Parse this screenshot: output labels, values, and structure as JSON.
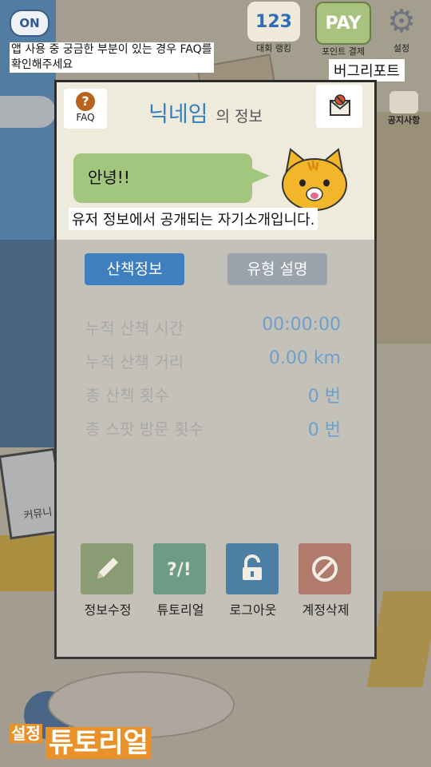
{
  "top": {
    "toggle_label": "ON",
    "rank_label": "대회 랭킹",
    "rank_glyph": "123",
    "pay_label": "포인트 결제",
    "pay_glyph": "PAY",
    "settings_label": "설정",
    "notice_label": "공지사항",
    "faq_hint": "앱 사용 중 궁금한 부분이 있는 경우 FAQ를 확인해주세요",
    "bug_hint": "버그리포트"
  },
  "panel": {
    "faq_label": "FAQ",
    "faq_glyph": "?",
    "nickname": "닉네임",
    "title_suffix": "의 정보",
    "greeting": "안녕!!",
    "intro_hint": "유저 정보에서 공개되는 자기소개입니다.",
    "tabs": [
      {
        "label": "산책정보",
        "active": true
      },
      {
        "label": "유형 설명",
        "active": false
      }
    ],
    "stats": [
      {
        "label": "누적 산책 시간",
        "value": "00:00:00"
      },
      {
        "label": "누적 산책 거리",
        "value": "0.00 km"
      },
      {
        "label": "총 산책 횟수",
        "value": "0 번"
      },
      {
        "label": "총 스팟 방문 횟수",
        "value": "0 번"
      }
    ],
    "actions": [
      {
        "label": "정보수정",
        "icon": "pencil-icon"
      },
      {
        "label": "튜토리얼",
        "icon": "tutorial-icon"
      },
      {
        "label": "로그아웃",
        "icon": "unlock-icon"
      },
      {
        "label": "계정삭제",
        "icon": "ban-icon"
      }
    ]
  },
  "background": {
    "monitor_label": "커뮤니"
  },
  "footer": {
    "small": "설정",
    "big": "튜토리얼"
  },
  "colors": {
    "accent_blue": "#3f7fc0",
    "bubble_green": "#a3c67e",
    "tutorial_orange": "#e9922b"
  }
}
